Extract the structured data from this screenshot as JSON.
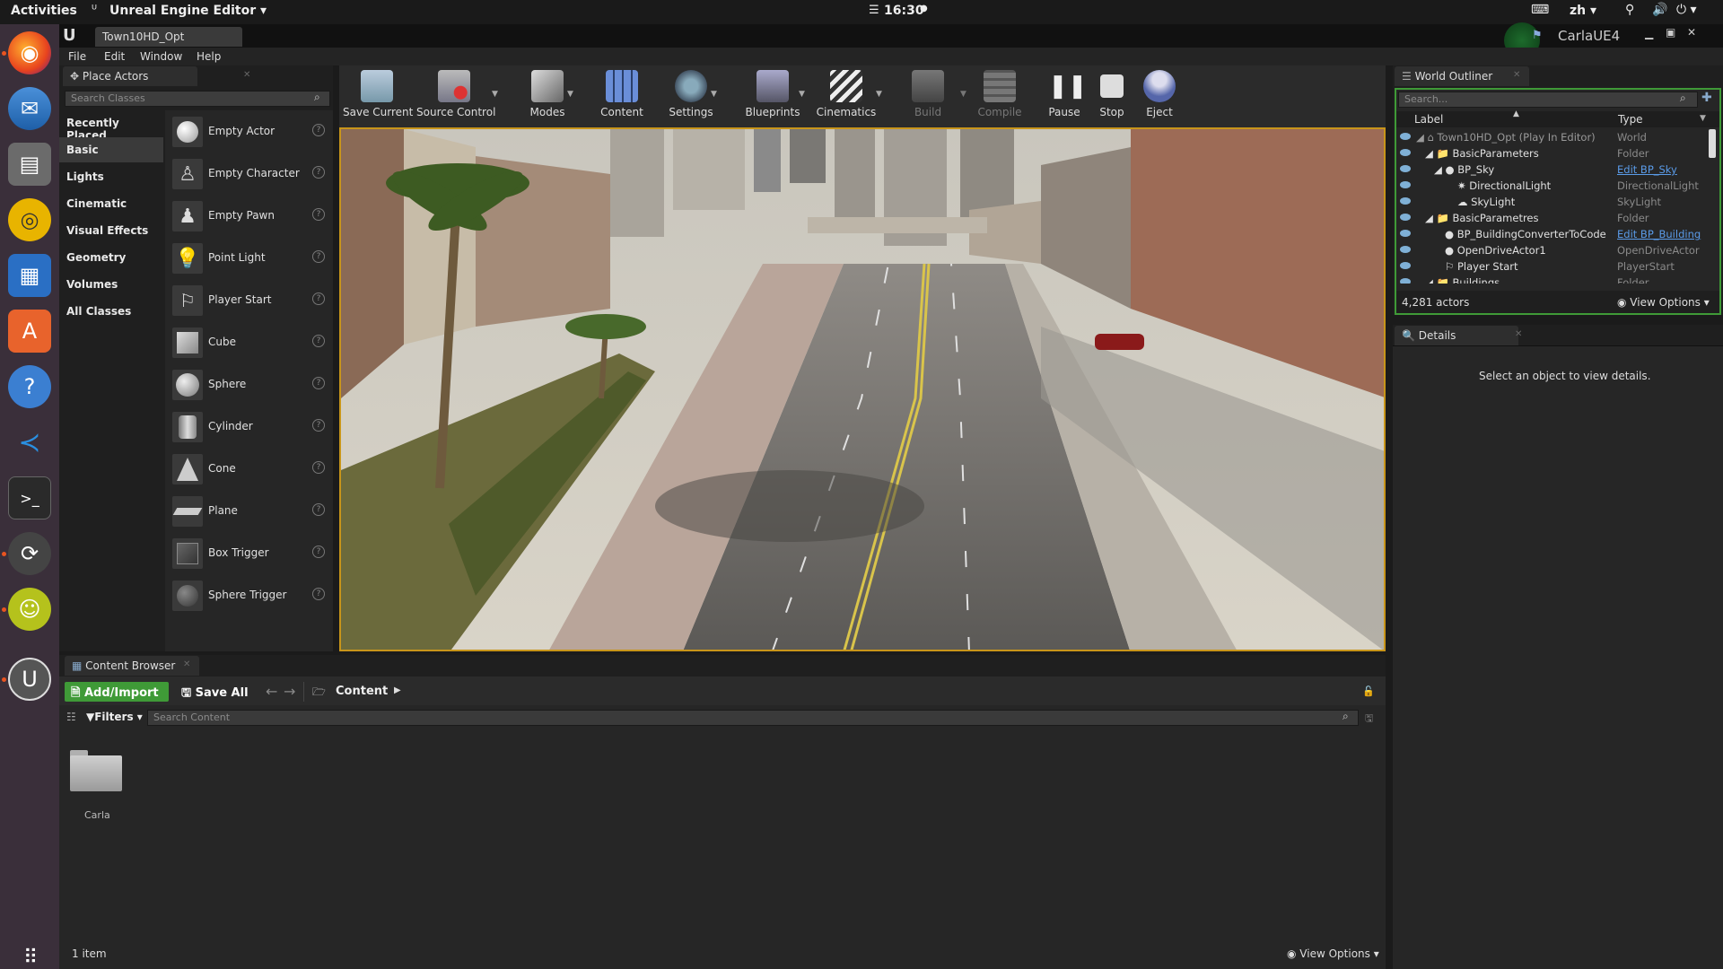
{
  "topbar": {
    "activities": "Activities",
    "app_name": "Unreal Engine Editor",
    "clock": "16:30",
    "lang": "zh"
  },
  "dock": {
    "icons": [
      "firefox-icon",
      "thunderbird-icon",
      "files-icon",
      "rhythmbox-icon",
      "writer-icon",
      "software-icon",
      "help-icon",
      "vscode-icon",
      "terminal-icon",
      "updater-icon",
      "carla-icon",
      "unreal-icon",
      "app-grid-icon"
    ]
  },
  "window": {
    "tab_title": "Town10HD_Opt",
    "project": "CarlaUE4"
  },
  "menu": [
    "File",
    "Edit",
    "Window",
    "Help"
  ],
  "place_actors": {
    "tab": "Place Actors",
    "search_placeholder": "Search Classes",
    "categories": [
      "Recently Placed",
      "Basic",
      "Lights",
      "Cinematic",
      "Visual Effects",
      "Geometry",
      "Volumes",
      "All Classes"
    ],
    "selected_category": "Basic",
    "actors": [
      "Empty Actor",
      "Empty Character",
      "Empty Pawn",
      "Point Light",
      "Player Start",
      "Cube",
      "Sphere",
      "Cylinder",
      "Cone",
      "Plane",
      "Box Trigger",
      "Sphere Trigger"
    ]
  },
  "toolbar": {
    "items": [
      {
        "label": "Save Current"
      },
      {
        "label": "Source Control"
      },
      {
        "label": "Modes"
      },
      {
        "label": "Content"
      },
      {
        "label": "Settings"
      },
      {
        "label": "Blueprints"
      },
      {
        "label": "Cinematics"
      },
      {
        "label": "Build"
      },
      {
        "label": "Compile"
      },
      {
        "label": "Pause"
      },
      {
        "label": "Stop"
      },
      {
        "label": "Eject"
      }
    ]
  },
  "outliner": {
    "tab": "World Outliner",
    "search_placeholder": "Search...",
    "col_label": "Label",
    "col_type": "Type",
    "rows": [
      {
        "name": "Town10HD_Opt (Play In Editor)",
        "type": "World"
      },
      {
        "name": "BasicParameters",
        "type": "Folder"
      },
      {
        "name": "BP_Sky",
        "type": "Edit BP_Sky"
      },
      {
        "name": "DirectionalLight",
        "type": "DirectionalLight"
      },
      {
        "name": "SkyLight",
        "type": "SkyLight"
      },
      {
        "name": "BasicParametres",
        "type": "Folder"
      },
      {
        "name": "BP_BuildingConverterToCode",
        "type": "Edit BP_Building"
      },
      {
        "name": "OpenDriveActor1",
        "type": "OpenDriveActor"
      },
      {
        "name": "Player Start",
        "type": "PlayerStart"
      },
      {
        "name": "Buildings",
        "type": "Folder"
      }
    ],
    "actor_count": "4,281 actors",
    "view_options": "View Options"
  },
  "details": {
    "tab": "Details",
    "empty_msg": "Select an object to view details."
  },
  "content_browser": {
    "tab": "Content Browser",
    "add_import": "Add/Import",
    "save_all": "Save All",
    "path": "Content",
    "filters": "Filters",
    "search_placeholder": "Search Content",
    "folder_name": "Carla",
    "item_count": "1 item",
    "view_options": "View Options"
  },
  "colors": {
    "accent_orange": "#c8951a",
    "add_green": "#3f9a37",
    "link_blue": "#5a9be8"
  }
}
